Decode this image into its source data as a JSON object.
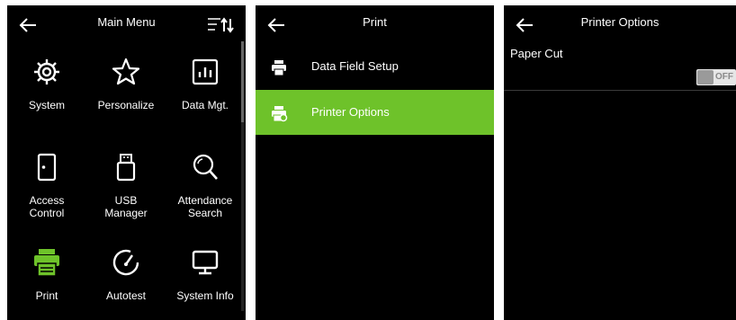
{
  "main_menu": {
    "title": "Main Menu",
    "items": [
      {
        "label": "System",
        "icon": "gear-icon"
      },
      {
        "label": "Personalize",
        "icon": "star-icon"
      },
      {
        "label": "Data Mgt.",
        "icon": "chart-icon"
      },
      {
        "label": "Access\nControl",
        "icon": "door-icon"
      },
      {
        "label": "USB\nManager",
        "icon": "usb-icon"
      },
      {
        "label": "Attendance\nSearch",
        "icon": "search-icon"
      },
      {
        "label": "Print",
        "icon": "printer-icon"
      },
      {
        "label": "Autotest",
        "icon": "gauge-icon"
      },
      {
        "label": "System Info",
        "icon": "monitor-icon"
      }
    ]
  },
  "print_menu": {
    "title": "Print",
    "items": [
      {
        "label": "Data Field Setup",
        "icon": "printer-icon"
      },
      {
        "label": "Printer Options",
        "icon": "printer-settings-icon"
      }
    ],
    "selected_index": 1
  },
  "printer_options": {
    "title": "Printer Options",
    "paper_cut_label": "Paper Cut",
    "paper_cut_state": "OFF"
  },
  "colors": {
    "accent": "#6ec22a",
    "background": "#000000",
    "text": "#ffffff"
  }
}
